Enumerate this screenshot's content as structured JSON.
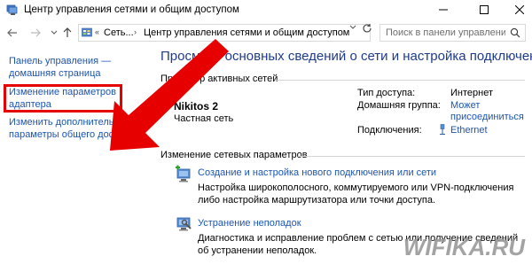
{
  "window": {
    "title": "Центр управления сетями и общим доступом"
  },
  "address": {
    "crumb_1": "Сеть...",
    "crumb_2": "Центр управления сетями и общим доступом",
    "search_placeholder": "Поиск в панели управления"
  },
  "left_pane": {
    "link_home_line1": "Панель управления —",
    "link_home_line2": "домашняя страница",
    "link_adapter_line1": "Изменение параметров",
    "link_adapter_line2": "адаптера",
    "link_sharing_line1": "Изменить дополнительные",
    "link_sharing_line2": "параметры общего доступа"
  },
  "main": {
    "heading": "Просмотр основных сведений о сети и настройка подключений",
    "active_networks_title": "Просмотр активных сетей",
    "network": {
      "name": "Nikitos  2",
      "type": "Частная сеть",
      "access_type_label": "Тип доступа:",
      "access_type_value": "Интернет",
      "homegroup_label": "Домашняя группа:",
      "homegroup_value_line1": "Может",
      "homegroup_value_line2": "присоединиться",
      "connections_label": "Подключения:",
      "connections_value": "Ethernet"
    },
    "change_settings_title": "Изменение сетевых параметров",
    "tasks": [
      {
        "link": "Создание и настройка нового подключения или сети",
        "desc": "Настройка широкополосного, коммутируемого или VPN-подключения либо настройка маршрутизатора или точки доступа."
      },
      {
        "link": "Устранение неполадок",
        "desc": "Диагностика и исправление проблем с сетью или получение сведений об устранении неполадок."
      }
    ]
  },
  "watermark": "WIFIKA.RU",
  "colors": {
    "link": "#1a55b0",
    "heading": "#1e3a8a",
    "highlight": "#e60000"
  }
}
